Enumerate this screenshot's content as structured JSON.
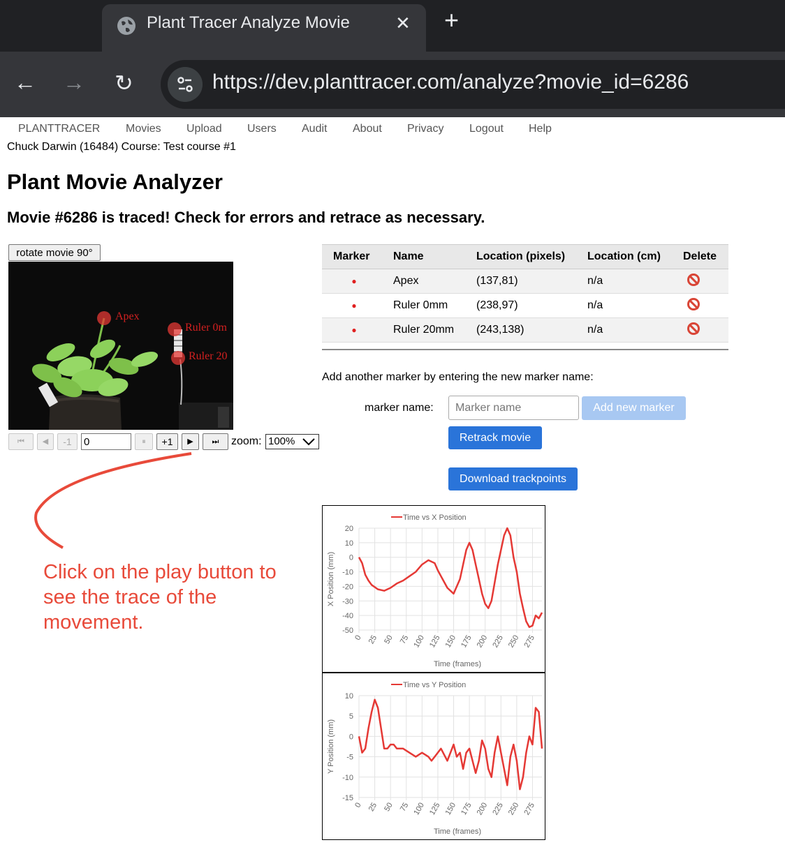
{
  "browser": {
    "tab_title": "Plant Tracer Analyze Movie",
    "new_tab_icon": "+",
    "url": "https://dev.planttracer.com/analyze?movie_id=6286"
  },
  "nav": {
    "items": [
      "PLANTTRACER",
      "Movies",
      "Upload",
      "Users",
      "Audit",
      "About",
      "Privacy",
      "Logout",
      "Help"
    ]
  },
  "user_line": "Chuck Darwin (16484) Course: Test course #1",
  "page_title": "Plant Movie Analyzer",
  "status_heading": "Movie #6286 is traced! Check for errors and retrace as necessary.",
  "rotate_button": "rotate movie 90°",
  "movie_labels": {
    "apex": "Apex",
    "ruler0": "Ruler 0m",
    "ruler20": "Ruler 20"
  },
  "controls": {
    "minus1": "-1",
    "frame_value": "0",
    "plus1": "+1",
    "zoom_label": "zoom:",
    "zoom_value": "100%"
  },
  "annotation": "Click on the play button to see the trace of the movement.",
  "table": {
    "headers": [
      "Marker",
      "Name",
      "Location (pixels)",
      "Location (cm)",
      "Delete"
    ],
    "rows": [
      {
        "name": "Apex",
        "loc_px": "(137,81)",
        "loc_cm": "n/a"
      },
      {
        "name": "Ruler 0mm",
        "loc_px": "(238,97)",
        "loc_cm": "n/a"
      },
      {
        "name": "Ruler 20mm",
        "loc_px": "(243,138)",
        "loc_cm": "n/a"
      }
    ],
    "marker_color": "#e02020"
  },
  "add_marker": {
    "prompt": "Add another marker by entering the new marker name:",
    "label": "marker name:",
    "placeholder": "Marker name",
    "add_button": "Add new marker",
    "retrack_button": "Retrack movie",
    "download_button": "Download trackpoints"
  },
  "chart_data": [
    {
      "type": "line",
      "title": "",
      "series": [
        {
          "name": "Time vs X Position",
          "color": "#e53935",
          "x": [
            0,
            5,
            10,
            15,
            20,
            30,
            40,
            50,
            60,
            70,
            80,
            90,
            100,
            110,
            120,
            125,
            130,
            140,
            150,
            160,
            165,
            170,
            175,
            180,
            185,
            190,
            195,
            200,
            205,
            210,
            220,
            225,
            230,
            235,
            240,
            245,
            250,
            255,
            260,
            265,
            270,
            275,
            280,
            285,
            290
          ],
          "y": [
            0,
            -4,
            -12,
            -16,
            -19,
            -22,
            -23,
            -21,
            -18,
            -16,
            -13,
            -10,
            -5,
            -2,
            -4,
            -9,
            -13,
            -21,
            -25,
            -15,
            -5,
            5,
            10,
            5,
            -5,
            -15,
            -25,
            -32,
            -35,
            -30,
            -5,
            5,
            15,
            20,
            15,
            0,
            -10,
            -25,
            -35,
            -44,
            -48,
            -47,
            -40,
            -42,
            -38
          ]
        }
      ],
      "xlabel": "Time (frames)",
      "ylabel": "X Position (mm)",
      "xticks": [
        0,
        25,
        50,
        75,
        100,
        125,
        150,
        175,
        200,
        225,
        250,
        275
      ],
      "yticks": [
        20,
        10,
        0,
        -10,
        -20,
        -30,
        -40,
        -50
      ],
      "ylim": [
        -50,
        20
      ],
      "xlim": [
        0,
        290
      ],
      "grid": true,
      "legend": "top"
    },
    {
      "type": "line",
      "title": "",
      "series": [
        {
          "name": "Time vs Y Position",
          "color": "#e53935",
          "x": [
            0,
            5,
            10,
            15,
            20,
            25,
            30,
            35,
            40,
            45,
            50,
            55,
            60,
            70,
            80,
            90,
            100,
            110,
            115,
            120,
            130,
            140,
            150,
            155,
            160,
            165,
            170,
            175,
            180,
            185,
            190,
            195,
            200,
            205,
            210,
            215,
            220,
            225,
            230,
            235,
            240,
            245,
            250,
            255,
            260,
            265,
            270,
            275,
            280,
            285,
            290
          ],
          "y": [
            0,
            -4,
            -3,
            2,
            6,
            9,
            7,
            2,
            -3,
            -3,
            -2,
            -2,
            -3,
            -3,
            -4,
            -5,
            -4,
            -5,
            -6,
            -5,
            -3,
            -6,
            -2,
            -5,
            -4,
            -8,
            -4,
            -3,
            -6,
            -9,
            -6,
            -1,
            -3,
            -8,
            -10,
            -4,
            0,
            -4,
            -8,
            -12,
            -5,
            -2,
            -6,
            -13,
            -10,
            -4,
            0,
            -2,
            7,
            6,
            -3
          ]
        }
      ],
      "xlabel": "Time (frames)",
      "ylabel": "Y Position (mm)",
      "xticks": [
        0,
        25,
        50,
        75,
        100,
        125,
        150,
        175,
        200,
        225,
        250,
        275
      ],
      "yticks": [
        10,
        5,
        0,
        -5,
        -10,
        -15
      ],
      "ylim": [
        -15,
        10
      ],
      "xlim": [
        0,
        290
      ],
      "grid": true,
      "legend": "top"
    }
  ]
}
